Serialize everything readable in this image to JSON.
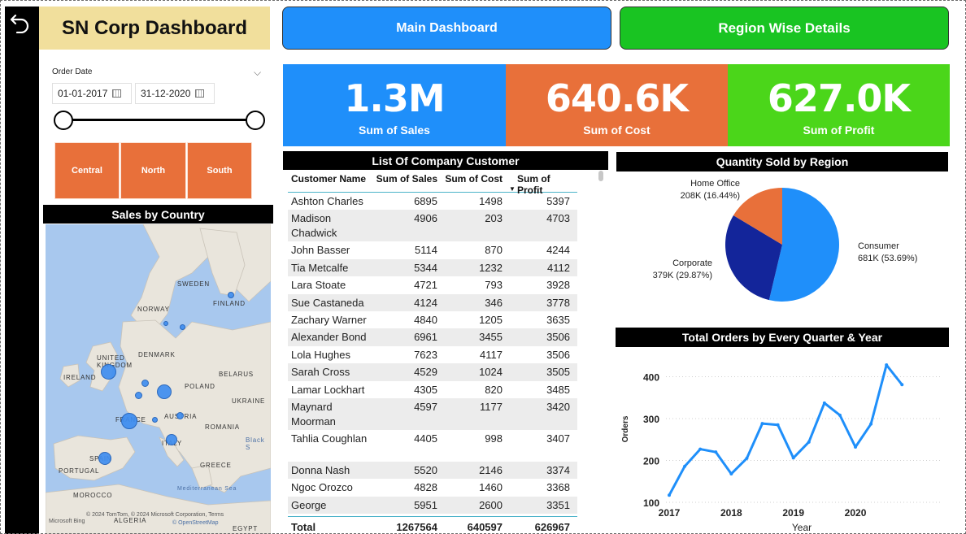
{
  "title": "SN Corp Dashboard",
  "nav": {
    "main": "Main Dashboard",
    "region": "Region Wise Details"
  },
  "slicer": {
    "label": "Order Date",
    "start": "01-01-2017",
    "end": "31-12-2020"
  },
  "regions": [
    "Central",
    "North",
    "South"
  ],
  "kpis": [
    {
      "value": "1.3M",
      "label": "Sum of Sales",
      "color": "#1f8ffa"
    },
    {
      "value": "640.6K",
      "label": "Sum of Cost",
      "color": "#e8703a"
    },
    {
      "value": "627.0K",
      "label": "Sum of Profit",
      "color": "#4bd61a"
    }
  ],
  "map": {
    "title": "Sales by Country",
    "labels": [
      "SWEDEN",
      "NORWAY",
      "FINLAND",
      "UNITED KINGDOM",
      "DENMARK",
      "IRELAND",
      "BELARUS",
      "POLAND",
      "UKRAINE",
      "FRANCE",
      "AUSTRIA",
      "ROMANIA",
      "ITALY",
      "Black S",
      "SPAIN",
      "PORTUGAL",
      "GREECE",
      "Mediterranean Sea",
      "MOROCCO",
      "ALGERIA",
      "EGYPT"
    ],
    "attribution": "© 2024 TomTom, © 2024 Microsoft Corporation, Terms",
    "attribution2": "© OpenStreetMap",
    "provider": "Microsoft Bing"
  },
  "table": {
    "title": "List Of Company Customer",
    "headers": [
      "Customer Name",
      "Sum of Sales",
      "Sum of Cost",
      "Sum of Profit"
    ],
    "rows": [
      [
        "Ashton Charles",
        "6895",
        "1498",
        "5397"
      ],
      [
        "Madison Chadwick",
        "4906",
        "203",
        "4703"
      ],
      [
        "John Basser",
        "5114",
        "870",
        "4244"
      ],
      [
        "Tia Metcalfe",
        "5344",
        "1232",
        "4112"
      ],
      [
        "Lara Stoate",
        "4721",
        "793",
        "3928"
      ],
      [
        "Sue Castaneda",
        "4124",
        "346",
        "3778"
      ],
      [
        "Zachary Warner",
        "4840",
        "1205",
        "3635"
      ],
      [
        "Alexander Bond",
        "6961",
        "3455",
        "3506"
      ],
      [
        "Lola Hughes",
        "7623",
        "4117",
        "3506"
      ],
      [
        "Sarah Cross",
        "4529",
        "1024",
        "3505"
      ],
      [
        "Lamar Lockhart",
        "4305",
        "820",
        "3485"
      ],
      [
        "Maynard Moorman",
        "4597",
        "1177",
        "3420"
      ],
      [
        "Tahlia Coughlan",
        "4405",
        "998",
        "3407"
      ],
      [
        "Donna Nash",
        "5520",
        "2146",
        "3374"
      ],
      [
        "Ngoc Orozco",
        "4828",
        "1460",
        "3368"
      ],
      [
        "George",
        "5951",
        "2600",
        "3351"
      ]
    ],
    "total": [
      "Total",
      "1267564",
      "640597",
      "626967"
    ]
  },
  "pie_title": "Quantity Sold by Region",
  "line_title": "Total Orders by Every Quarter & Year",
  "chart_data": [
    {
      "type": "pie",
      "title": "Quantity Sold by Region",
      "slices": [
        {
          "name": "Consumer",
          "value": 681,
          "label": "681K (53.69%)",
          "color": "#1f8ffa"
        },
        {
          "name": "Corporate",
          "value": 379,
          "label": "379K (29.87%)",
          "color": "#13259a"
        },
        {
          "name": "Home Office",
          "value": 208,
          "label": "208K (16.44%)",
          "color": "#e8703a"
        }
      ]
    },
    {
      "type": "line",
      "title": "Total Orders by Every Quarter & Year",
      "xlabel": "Year",
      "ylabel": "Orders",
      "x_ticks": [
        "2017",
        "2018",
        "2019",
        "2020"
      ],
      "y_ticks": [
        100,
        200,
        300,
        400
      ],
      "ylim": [
        100,
        430
      ],
      "grid": true,
      "color": "#1f8ffa",
      "x": [
        "2017 Q1",
        "2017 Q2",
        "2017 Q3",
        "2017 Q4",
        "2018 Q1",
        "2018 Q2",
        "2018 Q3",
        "2018 Q4",
        "2019 Q1",
        "2019 Q2",
        "2019 Q3",
        "2019 Q4",
        "2020 Q1",
        "2020 Q2",
        "2020 Q3",
        "2020 Q4"
      ],
      "values": [
        117,
        186,
        227,
        220,
        168,
        205,
        288,
        285,
        206,
        244,
        337,
        308,
        232,
        287,
        428,
        381
      ]
    }
  ]
}
